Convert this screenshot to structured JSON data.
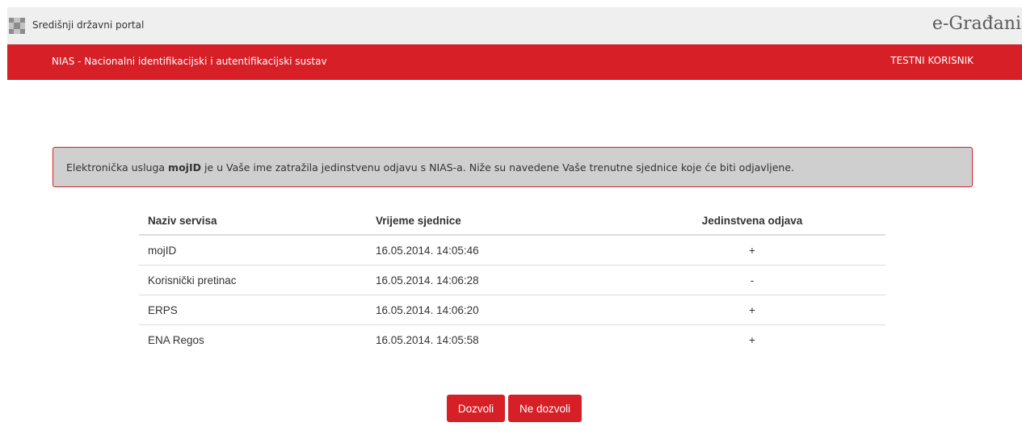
{
  "header": {
    "portal_link": "Središnji državni portal",
    "brand": "e-Građani",
    "logo_icon": "checkerboard-logo-icon"
  },
  "navbar": {
    "system_title": "NIAS - Nacionalni identifikacijski i autentifikacijski sustav",
    "user_label": "TESTNI KORISNIK",
    "background_color": "#d61f26"
  },
  "notice": {
    "prefix": "Elektronička usluga ",
    "service": "mojID",
    "suffix": " je u Vaše ime zatražila jedinstvenu odjavu s NIAS-a. Niže su navedene Vaše trenutne sjednice koje će biti odjavljene.",
    "background_color": "#cfcfcf",
    "border_color": "#d61f26"
  },
  "table": {
    "headers": [
      "Naziv servisa",
      "Vrijeme sjednice",
      "Jedinstvena odjava"
    ],
    "rows": [
      {
        "service": "mojID",
        "time": "16.05.2014. 14:05:46",
        "logout": "+"
      },
      {
        "service": "Korisnički pretinac",
        "time": "16.05.2014. 14:06:28",
        "logout": "-"
      },
      {
        "service": "ERPS",
        "time": "16.05.2014. 14:06:20",
        "logout": "+"
      },
      {
        "service": "ENA Regos",
        "time": "16.05.2014. 14:05:58",
        "logout": "+"
      }
    ]
  },
  "actions": {
    "allow_label": "Dozvoli",
    "deny_label": "Ne dozvoli",
    "button_color": "#d61f26"
  }
}
